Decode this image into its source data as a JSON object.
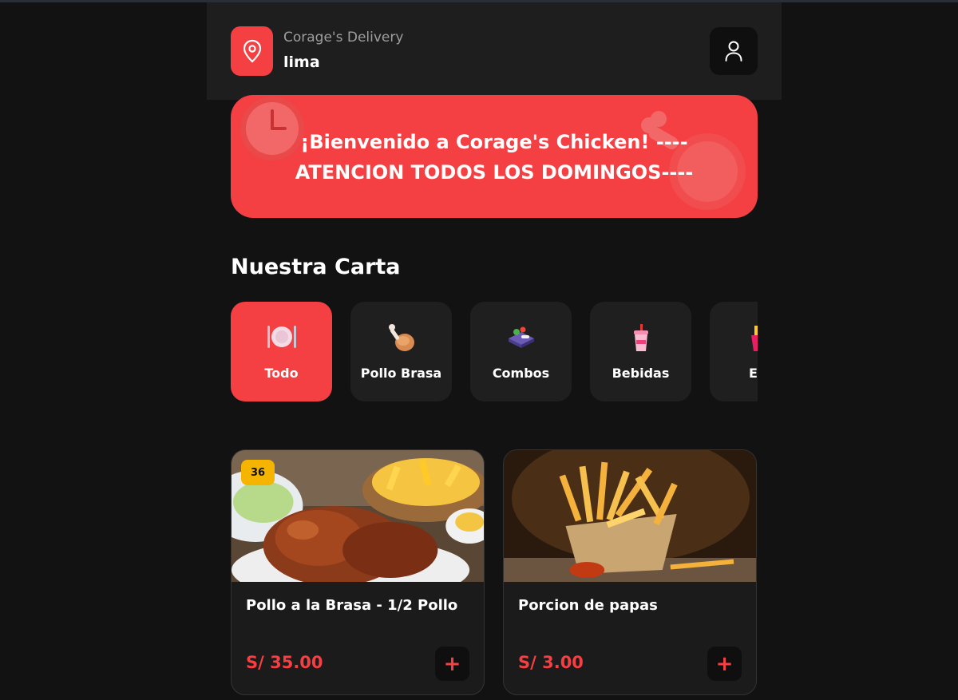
{
  "header": {
    "brand": "Corage's Delivery",
    "city": "lima",
    "location_icon": "map-pin-icon",
    "user_icon": "user-icon"
  },
  "banner": {
    "line1": "¡Bienvenido a Corage's Chicken! ----",
    "line2": "ATENCION TODOS LOS DOMINGOS----"
  },
  "menu": {
    "title": "Nuestra Carta",
    "categories": [
      {
        "label": "Todo",
        "icon": "plate-icon",
        "active": true
      },
      {
        "label": "Pollo Brasa",
        "icon": "chicken-leg-icon",
        "active": false
      },
      {
        "label": "Combos",
        "icon": "bento-box-icon",
        "active": false
      },
      {
        "label": "Bebidas",
        "icon": "drink-cup-icon",
        "active": false
      },
      {
        "label": "Ext",
        "icon": "fries-icon",
        "active": false
      }
    ]
  },
  "products": [
    {
      "name": "Pollo a la Brasa - 1/2 Pollo",
      "price": "S/ 35.00",
      "badge": "36",
      "image": "rotisserie-chicken-photo"
    },
    {
      "name": "Porcion de papas",
      "price": "S/ 3.00",
      "image": "french-fries-photo"
    }
  ],
  "add_label": "+",
  "colors": {
    "accent": "#f43f43",
    "background": "#121212",
    "surface": "#1e1e1e",
    "badge": "#f5b400"
  }
}
